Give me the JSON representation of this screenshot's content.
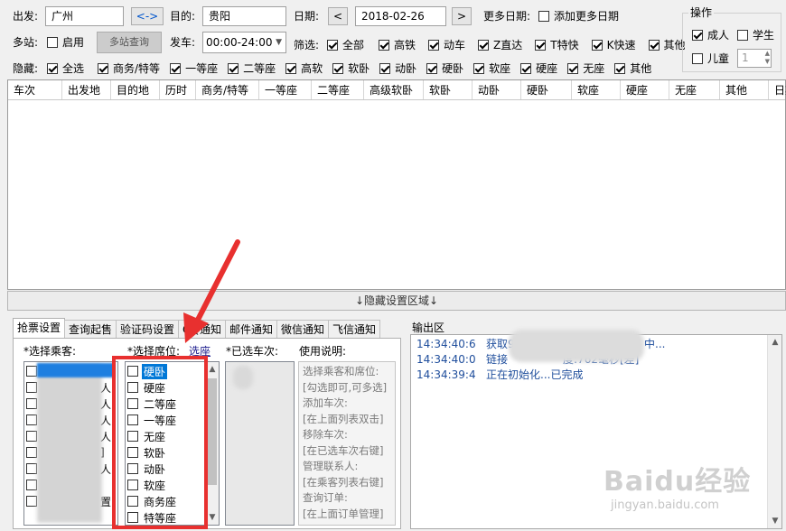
{
  "search": {
    "from_label": "出发:",
    "from_value": "广州",
    "swap_label": "<->",
    "to_label": "目的:",
    "to_value": "贵阳",
    "date_label": "日期:",
    "date_value": "2018-02-26",
    "prev_label": "<",
    "next_label": ">",
    "more_dates_label": "更多日期:",
    "add_more_dates_label": "添加更多日期",
    "multi_label": "多站:",
    "enable_label": "启用",
    "multi_query_label": "多站查询",
    "depart_label": "发车:",
    "depart_value": "00:00-24:00",
    "filter_label": "筛选:",
    "hide_label": "隐藏:"
  },
  "filters": [
    {
      "label": "全部",
      "checked": true
    },
    {
      "label": "高铁",
      "checked": true
    },
    {
      "label": "动车",
      "checked": true
    },
    {
      "label": "Z直达",
      "checked": true
    },
    {
      "label": "T特快",
      "checked": true
    },
    {
      "label": "K快速",
      "checked": true
    },
    {
      "label": "其他",
      "checked": true
    }
  ],
  "hides": [
    {
      "label": "全选",
      "checked": true
    },
    {
      "label": "商务/特等",
      "checked": true
    },
    {
      "label": "一等座",
      "checked": true
    },
    {
      "label": "二等座",
      "checked": true
    },
    {
      "label": "高软",
      "checked": true
    },
    {
      "label": "软卧",
      "checked": true
    },
    {
      "label": "动卧",
      "checked": true
    },
    {
      "label": "硬卧",
      "checked": true
    },
    {
      "label": "软座",
      "checked": true
    },
    {
      "label": "硬座",
      "checked": true
    },
    {
      "label": "无座",
      "checked": true
    },
    {
      "label": "其他",
      "checked": true
    }
  ],
  "ops": {
    "title": "操作",
    "adult": "成人",
    "student": "学生",
    "child": "儿童",
    "count": "1"
  },
  "columns": [
    "车次",
    "出发地",
    "目的地",
    "历时",
    "商务/特等",
    "一等座",
    "二等座",
    "高级软卧",
    "软卧",
    "动卧",
    "硬卧",
    "软座",
    "硬座",
    "无座",
    "其他",
    "日期"
  ],
  "hide_area_label": "↓隐藏设置区域↓",
  "tabs": [
    "抢票设置",
    "查询起售",
    "验证码设置",
    "QQ通知",
    "邮件通知",
    "微信通知",
    "飞信通知"
  ],
  "panel": {
    "passengers_label": "*选择乘客:",
    "seats_label": "*选择席位:",
    "seats_link": "选座",
    "trains_label": "*已选车次:",
    "help_label": "使用说明:",
    "passenger_rows": [
      "",
      "人]",
      "人]",
      "人]",
      "人]",
      "]",
      "人]",
      "",
      "置]"
    ]
  },
  "seats": [
    {
      "label": "硬卧",
      "selected": true
    },
    {
      "label": "硬座",
      "selected": false
    },
    {
      "label": "二等座",
      "selected": false
    },
    {
      "label": "一等座",
      "selected": false
    },
    {
      "label": "无座",
      "selected": false
    },
    {
      "label": "软卧",
      "selected": false
    },
    {
      "label": "动卧",
      "selected": false
    },
    {
      "label": "软座",
      "selected": false
    },
    {
      "label": "商务座",
      "selected": false
    },
    {
      "label": "特等座",
      "selected": false
    }
  ],
  "help_lines": [
    "选择乘客和席位:",
    "[勾选即可,可多选]",
    "添加车次:",
    "[在上面列表双击]",
    "移除车次:",
    "[在已选车次右键]",
    "管理联系人:",
    "[在乘客列表右键]",
    "查询订单:",
    "[在上面订单管理]"
  ],
  "output": {
    "label": "输出区",
    "lines": [
      "14:34:40:6   获取9",
      "14:34:40:0   链接                度:762毫秒[差]",
      "14:34:39:4   正在初始化...已完成"
    ],
    "line1_tail": "中..."
  },
  "watermark": {
    "logo": "Baidu经验",
    "url": "jingyan.baidu.com"
  },
  "colors": {
    "annotation_red": "#e8302f",
    "selection_blue": "#0078d7",
    "log_blue": "#1f4e9c"
  }
}
